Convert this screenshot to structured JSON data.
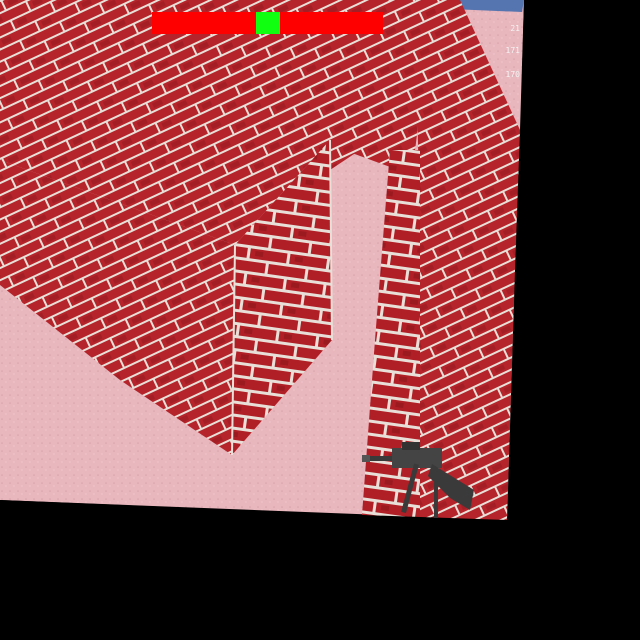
{
  "game": {
    "scene": "brick-maze",
    "colors": {
      "floor": "#e8b6bd",
      "brick": "#b5242a",
      "mortar": "#e8e0d8",
      "sky": "#5575b0",
      "health_bar": "#ff0000",
      "health_marker": "#10ff10",
      "weapon": "#3a3a3a"
    }
  },
  "hud": {
    "bar_marker_fraction": 0.5,
    "stats": [
      "21",
      "171",
      "170"
    ],
    "weapon_icon": "rifle-icon"
  }
}
